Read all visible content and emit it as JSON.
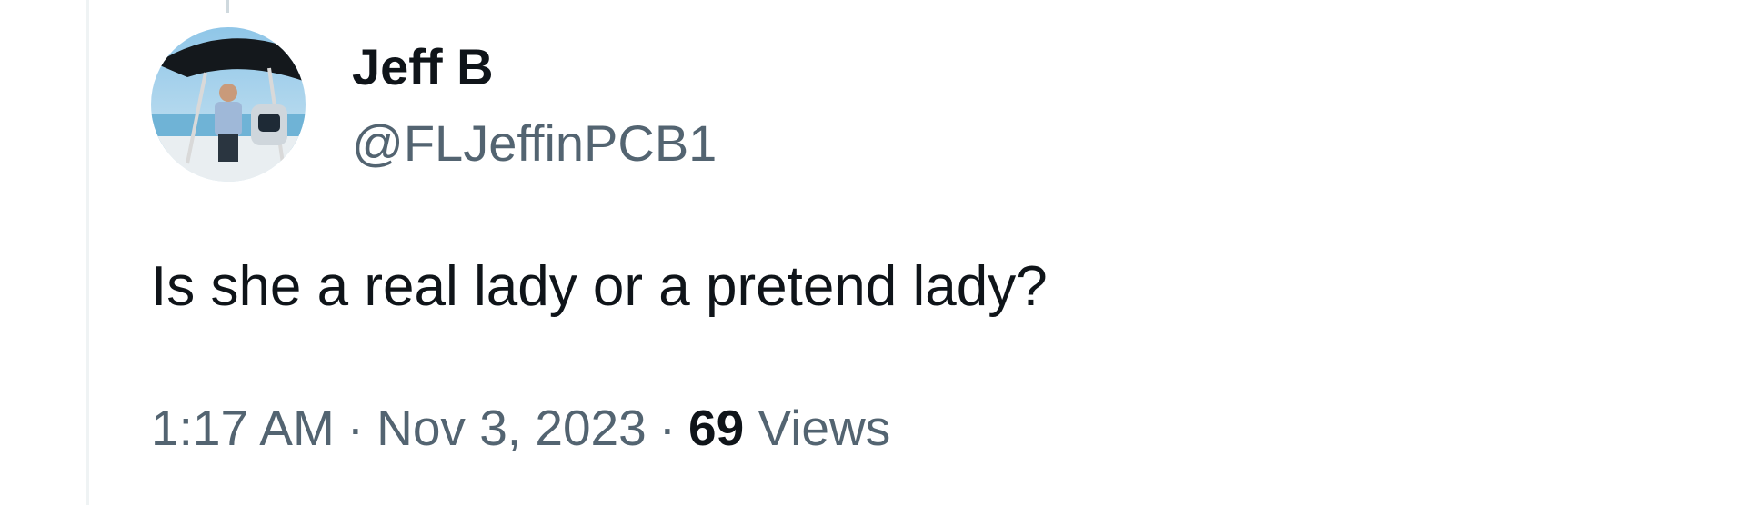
{
  "tweet": {
    "author": {
      "name": "Jeff B",
      "handle": "@FLJeffinPCB1",
      "avatar_icon": "profile-photo-man-on-boat"
    },
    "text": "Is she a real lady or a pretend lady?",
    "time": "1:17 AM",
    "date": "Nov 3, 2023",
    "separator": "·",
    "views_count": "69",
    "views_label": "Views"
  },
  "colors": {
    "text_primary": "#0f1419",
    "text_secondary": "#536471",
    "border": "#eff3f4",
    "thread_line": "#cfd9de"
  }
}
